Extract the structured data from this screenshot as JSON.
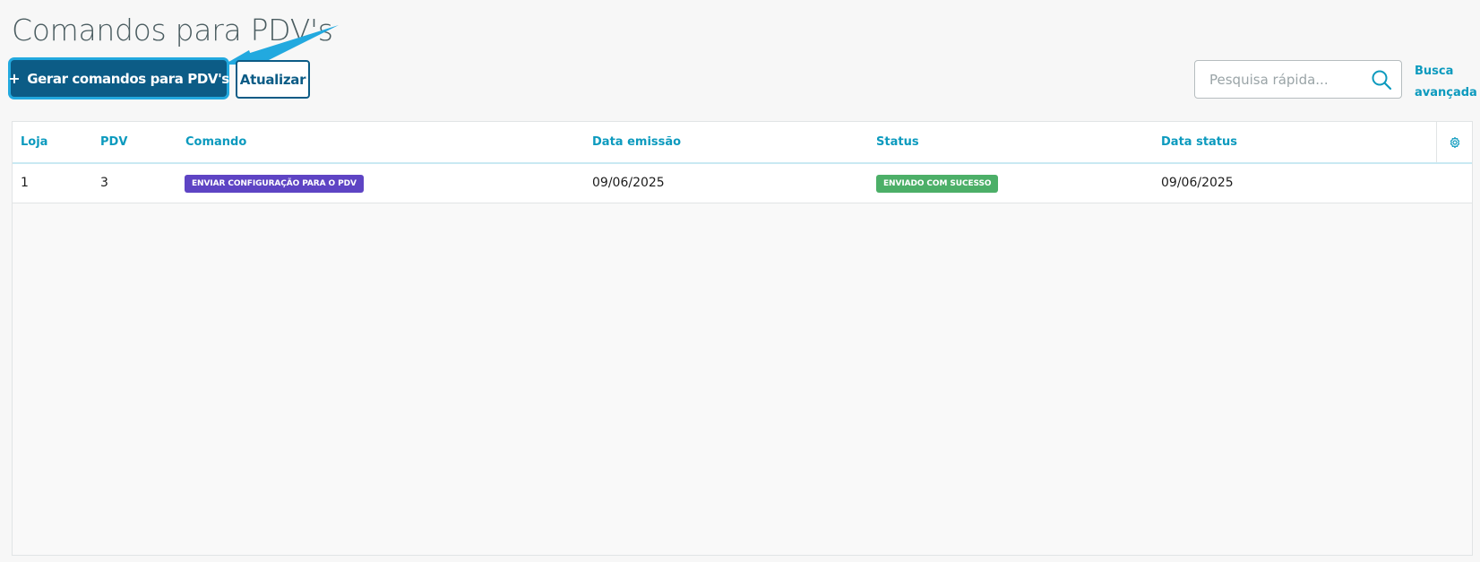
{
  "page": {
    "title": "Comandos para PDV's"
  },
  "toolbar": {
    "generate_label": "Gerar comandos para PDV's",
    "generate_icon": "plus-icon",
    "refresh_label": "Atualizar"
  },
  "search": {
    "placeholder": "Pesquisa rápida...",
    "value": "",
    "icon": "search-icon",
    "advanced_label": "Busca avançada"
  },
  "table": {
    "columns": [
      "Loja",
      "PDV",
      "Comando",
      "Data emissão",
      "Status",
      "Data status"
    ],
    "settings_icon": "gear-icon",
    "rows": [
      {
        "loja": "1",
        "pdv": "3",
        "comando": "ENVIAR CONFIGURAÇÃO PARA O PDV",
        "data_emissao": "09/06/2025",
        "status": "ENVIADO COM SUCESSO",
        "data_status": "09/06/2025"
      }
    ]
  },
  "colors": {
    "primary": "#0c5c86",
    "accent": "#0c9abe",
    "highlight": "#22a9df",
    "command_tag": "#5e44c4",
    "status_success": "#4caf68"
  }
}
